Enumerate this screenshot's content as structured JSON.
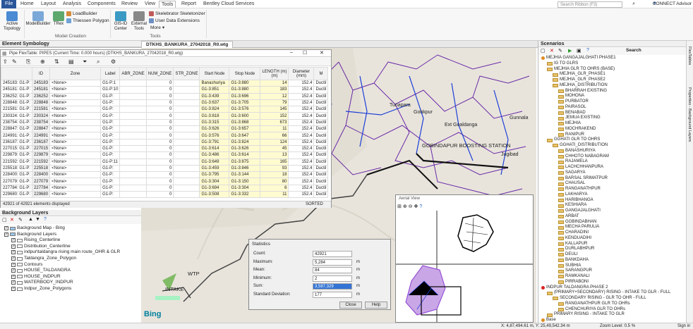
{
  "menu": [
    "File",
    "Home",
    "Layout",
    "Analysis",
    "Components",
    "Review",
    "View",
    "Tools",
    "Report",
    "Bentley Cloud Services"
  ],
  "search_placeholder": "Search Ribbon (F3)",
  "user": "CONNECT Advisor",
  "ribbon": {
    "active_topology": "Active\nTopology",
    "modelbuilder": "ModelBuilder",
    "trex": "TRex",
    "loadbuilder": "LoadBuilder",
    "thiessen": "Thiessen Polygon",
    "group_model": "Model Creation",
    "gis_id": "GIS-ID\nCenter",
    "external_tools": "External\nTools",
    "skelebrator": "Skelebrator Skeletonizer",
    "user_data": "User Data Extensions",
    "more": "More",
    "group_tools": "Tools"
  },
  "doc_tab": "DTKHS_BANKURA_27042018_R0.wtg",
  "element_symbology": "Element Symbology",
  "flextable": {
    "title": "Pipe FlexTable: PIPES (Current Time: 0.000 hours) (DTKHS_BANKURA_27042018_R0.wtg)",
    "columns": [
      "",
      "ID",
      "Zone",
      "Label",
      "ABR_ZONE",
      "NUM_ZONE",
      "STR_ZONE",
      "Start Node",
      "Stop Node",
      "LENGTH (m) (m)",
      "Diameter (mm)",
      "M"
    ],
    "rows": [
      [
        "245183: G1-P:",
        "245183",
        "<None>",
        "G1-P:1",
        "",
        "0",
        "",
        "Banashuriya",
        "G1-3:880",
        "14",
        "152.4",
        "Ductil"
      ],
      [
        "245181: G1-P:",
        "245181",
        "<None>",
        "G1-P:10",
        "",
        "0",
        "",
        "G1-3:851",
        "G1-3:880",
        "183",
        "152.4",
        "Ductil"
      ],
      [
        "236252: G1-P:",
        "236252",
        "<None>",
        "G1-P:",
        "",
        "0",
        "",
        "G1-3:439",
        "G1-3:696",
        "12",
        "152.4",
        "Ductil"
      ],
      [
        "228848: G1-P:",
        "228848",
        "<None>",
        "G1-P:",
        "",
        "0",
        "",
        "G1-3:637",
        "G1-3:705",
        "79",
        "152.4",
        "Ductil"
      ],
      [
        "221581: G1-P:",
        "221581",
        "<None>",
        "G1-P:",
        "",
        "0",
        "",
        "G1-3:824",
        "G1-3:576",
        "145",
        "152.4",
        "Ductil"
      ],
      [
        "230324: G1-P:",
        "230324",
        "<None>",
        "G1-P:",
        "",
        "0",
        "",
        "G1-3:818",
        "G1-3:600",
        "152",
        "152.4",
        "Ductil"
      ],
      [
        "238754: G1-P:",
        "238754",
        "<None>",
        "G1-P:",
        "",
        "0",
        "",
        "G1-3:315",
        "G1-3:868",
        "673",
        "152.4",
        "Ductil"
      ],
      [
        "228847: G1-P:",
        "228847",
        "<None>",
        "G1-P:",
        "",
        "0",
        "",
        "G1-3:626",
        "G1-3:657",
        "11",
        "152.4",
        "Ductil"
      ],
      [
        "224991: G1-P:",
        "224991",
        "<None>",
        "G1-P:",
        "",
        "0",
        "",
        "G1-3:576",
        "G1-3:647",
        "66",
        "152.4",
        "Ductil"
      ],
      [
        "236187: G1-P:",
        "236187",
        "<None>",
        "G1-P:",
        "",
        "0",
        "",
        "G1-3:791",
        "G1-3:824",
        "124",
        "152.4",
        "Ductil"
      ],
      [
        "227015: G1-P:",
        "227015",
        "<None>",
        "G1-P:",
        "",
        "0",
        "",
        "G1-3:614",
        "G1-3:626",
        "45",
        "152.4",
        "Ductil"
      ],
      [
        "229879: G1-P:",
        "229879",
        "<None>",
        "G1-P:",
        "",
        "0",
        "",
        "G1-3:486",
        "G1-3:614",
        "13",
        "152.4",
        "Ductil"
      ],
      [
        "221592: G1-P:",
        "221592",
        "<None>",
        "G1-P:11",
        "",
        "0",
        "",
        "G1-3:649",
        "G1-3:875",
        "165",
        "152.4",
        "Ductil"
      ],
      [
        "225518: G1-P:",
        "225518",
        "<None>",
        "G1-P:",
        "",
        "0",
        "",
        "G1-3:459",
        "G1-3:846",
        "93",
        "152.4",
        "Ductil"
      ],
      [
        "228400: G1-P:",
        "228400",
        "<None>",
        "G1-P:",
        "",
        "0",
        "",
        "G1-3:795",
        "G1-3:144",
        "18",
        "152.4",
        "Ductil"
      ],
      [
        "227079: G1-P:",
        "227079",
        "<None>",
        "G1-P:",
        "",
        "0",
        "",
        "G1-3:304",
        "G1-3:150",
        "80",
        "152.4",
        "Ductil"
      ],
      [
        "227784: G1-P:",
        "227784",
        "<None>",
        "G1-P:",
        "",
        "0",
        "",
        "G1-3:694",
        "G1-3:304",
        "6",
        "152.4",
        "Ductil"
      ],
      [
        "229680: G1-P:",
        "229680",
        "<None>",
        "G1-P:",
        "",
        "0",
        "",
        "G1-3:508",
        "G1-3:332",
        "11",
        "152.4",
        "Ductil"
      ]
    ],
    "status_left": "42921 of 42921 elements displayed",
    "status_right": "SORTED"
  },
  "bg_layers": {
    "title": "Background Layers",
    "items": [
      "Background Map - Bing",
      "Background Layers",
      "Rising_Centerline",
      "Distribution_Centerline",
      "indpur\\taldangra rising main route_OHR & GLR",
      "Taldangra_Zone_Polygon",
      "Contours",
      "HOUSE_TALDANGRA",
      "HOUSE_INDPUR",
      "WATERBODY_INDPUR",
      "Indpur_Zone_Polygons"
    ]
  },
  "map_labels": {
    "gohkpur": "Gohkpur",
    "tunapara": "Tunapara",
    "ext": "Ext Goaldanga",
    "gunnala": "Gunnala",
    "station": "GOBINDAPUR BOOSTING STATION",
    "jugibad": "Jugibad",
    "wtp": "WTP",
    "intake": "INTAKE",
    "bing": "Bing"
  },
  "stats": {
    "title": "Statistics",
    "labels": [
      "Count:",
      "Maximum:",
      "Mean:",
      "Minimum:",
      "Sum:",
      "Standard Deviation:"
    ],
    "values": [
      "42921",
      "5,284",
      "84",
      "2",
      "3,587,329",
      "177"
    ],
    "units": [
      "",
      "m",
      "m",
      "m",
      "m",
      "m"
    ],
    "close": "Close",
    "help": "Help"
  },
  "aerial_title": "Aerial View",
  "scenarios": {
    "title": "Scenarios",
    "search": "Search",
    "items": [
      "MEJHIA GANGAJALGHATI PHASE1",
      "IG TO GLRS",
      "MEJHIA GLR TO OHRS (BASE)",
      "MEJHIA_GLR_PHASE1",
      "MEJHIA_GLR_PHASE2",
      "MEJHIA_DISTRIBUTION",
      "BHARRAH EXISTING",
      "MOHONA",
      "PURBATOR",
      "PAIRASOL",
      "BENABAD",
      "JEMUA EXISTING",
      "MEJHIA",
      "MOCHRAKEND",
      "RANIPUR",
      "GGHATI GLR TO OHRS",
      "GGHATI_DISTRIBUTION",
      "BANASHURIYA",
      "CHHOTO NABAGRAM",
      "RAJAMELA",
      "LACHCHHANPURA",
      "SAGARYA",
      "BARSAL SRIMATPUR",
      "CHAUSAL",
      "RANGANATHPUR",
      "LAKHARYA",
      "HARIBHANGA",
      "KESHIARA",
      "GANGAJALGHATI",
      "ARBAT",
      "GOBINDABHAN",
      "MECHA PARULIA",
      "CHARADINI",
      "KENDUADIHI",
      "KALLAPUR",
      "DURLABHPUR",
      "DEULI",
      "BANKDAHA",
      "SUBHIA",
      "SARANGPUR",
      "RAMKANALI",
      "PIRRABONI",
      "INDPUR TALDANGRA PHASE 2",
      "(PRIMARY+SECONDARY) RISING - INTAKE TO GLR - FULL",
      "SECONDARY RISING - GLR TO OHR - FULL",
      "RANGANATHPUR GLR TO OHRs",
      "CHENCHURIYA GLR TO OHRs",
      "PRIMARY RISING - INTAKE TO GLR",
      "Base"
    ],
    "levels": [
      0,
      1,
      1,
      2,
      2,
      2,
      3,
      3,
      3,
      3,
      3,
      3,
      3,
      3,
      3,
      1,
      2,
      3,
      3,
      3,
      3,
      3,
      3,
      3,
      3,
      3,
      3,
      3,
      3,
      3,
      3,
      3,
      3,
      3,
      3,
      3,
      3,
      3,
      3,
      3,
      3,
      3,
      0,
      1,
      2,
      3,
      3,
      1,
      0
    ]
  },
  "side_tabs": [
    "FlexTables",
    "Properties - Background Layers"
  ],
  "status": {
    "coords": "X: 4,87,494.61 m, Y: 25,49,542.34 m",
    "zoom": "Zoom Level: 0.5 %",
    "signin": "Sign in"
  }
}
